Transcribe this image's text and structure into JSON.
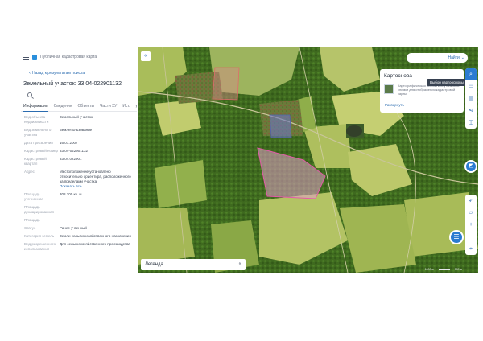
{
  "header": {
    "title": "Публичная кадастровая карта",
    "back_label": "Назад к результатам поиска"
  },
  "parcel": {
    "title": "Земельный участок: 33:04-022901132"
  },
  "tabs": [
    {
      "label": "Информация"
    },
    {
      "label": "Сведения"
    },
    {
      "label": "Объекты"
    },
    {
      "label": "Части ЗУ"
    },
    {
      "label": "Ист."
    }
  ],
  "info_rows": [
    {
      "key": "Вид объекта недвижимости",
      "value": "Земельный участок"
    },
    {
      "key": "Вид земельного участка",
      "value": "Землепользование"
    },
    {
      "key": "Дата присвоения",
      "value": "16.07.2007"
    },
    {
      "key": "Кадастровый номер",
      "value": "33:04-022901132"
    },
    {
      "key": "Кадастровый квартал",
      "value": "33:04:022901"
    },
    {
      "key": "Адрес",
      "value": "Местоположение установлено относительно ориентира, расположенного за пределами участка",
      "link": "Показать все"
    },
    {
      "key": "Площадь уточненная",
      "value": "308 700 кв. м"
    },
    {
      "key": "Площадь декларированная",
      "value": "–"
    },
    {
      "key": "Площадь",
      "value": "–"
    },
    {
      "key": "Статус",
      "value": "Ранее учтенный"
    },
    {
      "key": "Категория земель",
      "value": "Земли сельскохозяйственного назначения"
    },
    {
      "key": "Вид разрешенного использования",
      "value": "Для сельскохозяйственного производства"
    }
  ],
  "map": {
    "search_button": "Найти",
    "basemap_title": "Картоснова",
    "basemap_description": "Картографическая основа и спутниковые снимки для отображения кадастровой карты",
    "basemap_more": "Развернуть",
    "tooltip": "Выбор картоосновы",
    "legend_label": "Легенда",
    "scale_left": "1000 м",
    "scale_right": "500 м",
    "icons": [
      "search-icon",
      "printer-icon",
      "folder-icon",
      "share-icon",
      "layers-icon",
      "compass-icon",
      "plus-icon",
      "minus-icon",
      "ruler-icon",
      "chat-icon"
    ]
  }
}
